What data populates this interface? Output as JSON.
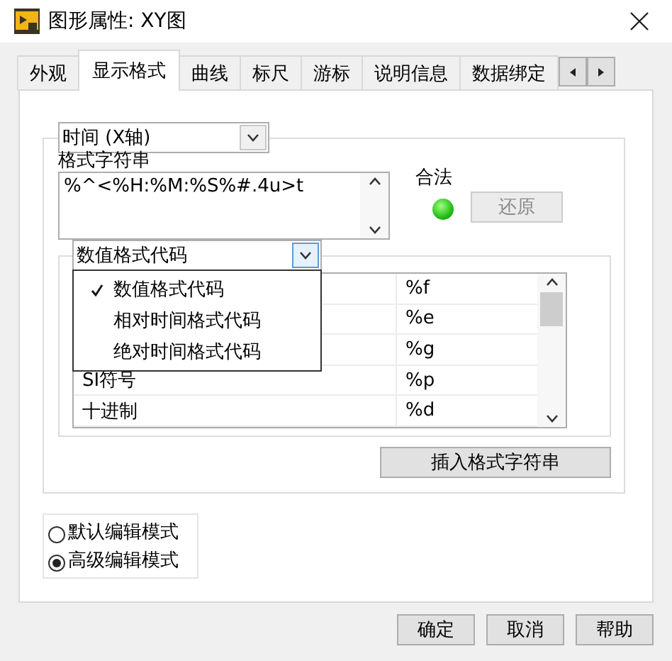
{
  "window": {
    "title": "图形属性: XY图"
  },
  "tabs": [
    {
      "label": "外观",
      "selected": false
    },
    {
      "label": "显示格式",
      "selected": true
    },
    {
      "label": "曲线",
      "selected": false
    },
    {
      "label": "标尺",
      "selected": false
    },
    {
      "label": "游标",
      "selected": false
    },
    {
      "label": "说明信息",
      "selected": false
    },
    {
      "label": "数据绑定",
      "selected": false
    }
  ],
  "axis_select": {
    "value": "时间  (X轴)"
  },
  "format_string": {
    "label": "格式字符串",
    "value": "%^<%H:%M:%S%#.4u>t"
  },
  "validity": {
    "label": "合法",
    "valid": true
  },
  "revert_button": {
    "label": "还原",
    "disabled": true
  },
  "code_type_select": {
    "value": "数值格式代码",
    "expanded": true,
    "options": [
      {
        "label": "数值格式代码",
        "selected": true
      },
      {
        "label": "相对时间格式代码",
        "selected": false
      },
      {
        "label": "绝对时间格式代码",
        "selected": false
      }
    ]
  },
  "codes": [
    {
      "code": "%f"
    },
    {
      "code": "%e"
    },
    {
      "code": "%g"
    },
    {
      "name": "SI符号",
      "code": "%p"
    },
    {
      "name": "十进制",
      "code": "%d"
    }
  ],
  "insert_button": {
    "label": "插入格式字符串"
  },
  "edit_modes": [
    {
      "label": "默认编辑模式",
      "selected": false
    },
    {
      "label": "高级编辑模式",
      "selected": true
    }
  ],
  "buttons": [
    {
      "label": "确定"
    },
    {
      "label": "取消"
    },
    {
      "label": "帮助"
    }
  ]
}
